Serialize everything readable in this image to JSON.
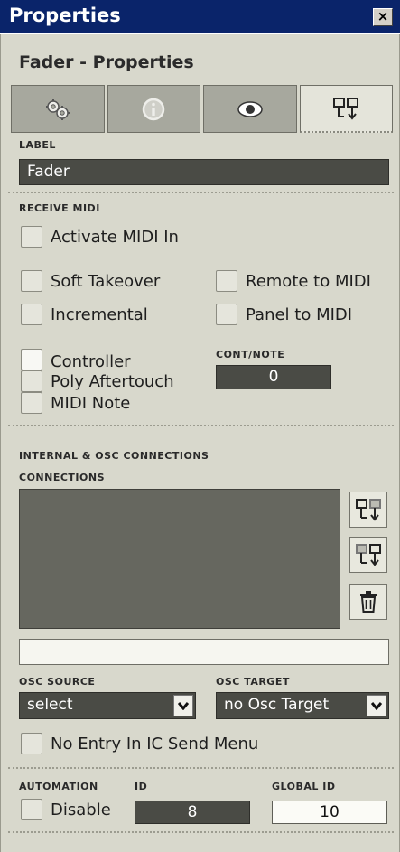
{
  "window": {
    "title": "Properties",
    "close_glyph": "×"
  },
  "header": {
    "title": "Fader - Properties"
  },
  "tabs": [
    {
      "icon": "gears-icon",
      "active": false
    },
    {
      "icon": "info-icon",
      "active": false
    },
    {
      "icon": "eye-icon",
      "active": false
    },
    {
      "icon": "connections-icon",
      "active": true
    }
  ],
  "label_section": {
    "caption": "LABEL",
    "value": "Fader"
  },
  "receive_midi": {
    "caption": "RECEIVE MIDI",
    "activate": "Activate MIDI In",
    "soft_takeover": "Soft Takeover",
    "remote_to_midi": "Remote to MIDI",
    "incremental": "Incremental",
    "panel_to_midi": "Panel to MIDI",
    "controller": "Controller",
    "poly_aftertouch": "Poly Aftertouch",
    "midi_note": "MIDI Note",
    "cont_note_caption": "CONT/NOTE",
    "cont_note_value": "0"
  },
  "connections": {
    "section_caption": "INTERNAL & OSC CONNECTIONS",
    "list_caption": "CONNECTIONS",
    "input_value": "",
    "osc_source_caption": "OSC SOURCE",
    "osc_source_value": "select",
    "osc_target_caption": "OSC TARGET",
    "osc_target_value": "no Osc Target",
    "no_entry": "No Entry In IC Send Menu"
  },
  "automation": {
    "caption": "AUTOMATION",
    "disable": "Disable",
    "id_caption": "ID",
    "id_value": "8",
    "global_id_caption": "GLOBAL ID",
    "global_id_value": "10"
  },
  "colors": {
    "title_bar": "#0a246a",
    "panel": "#d8d8cc",
    "field_dark": "#4a4b45"
  }
}
